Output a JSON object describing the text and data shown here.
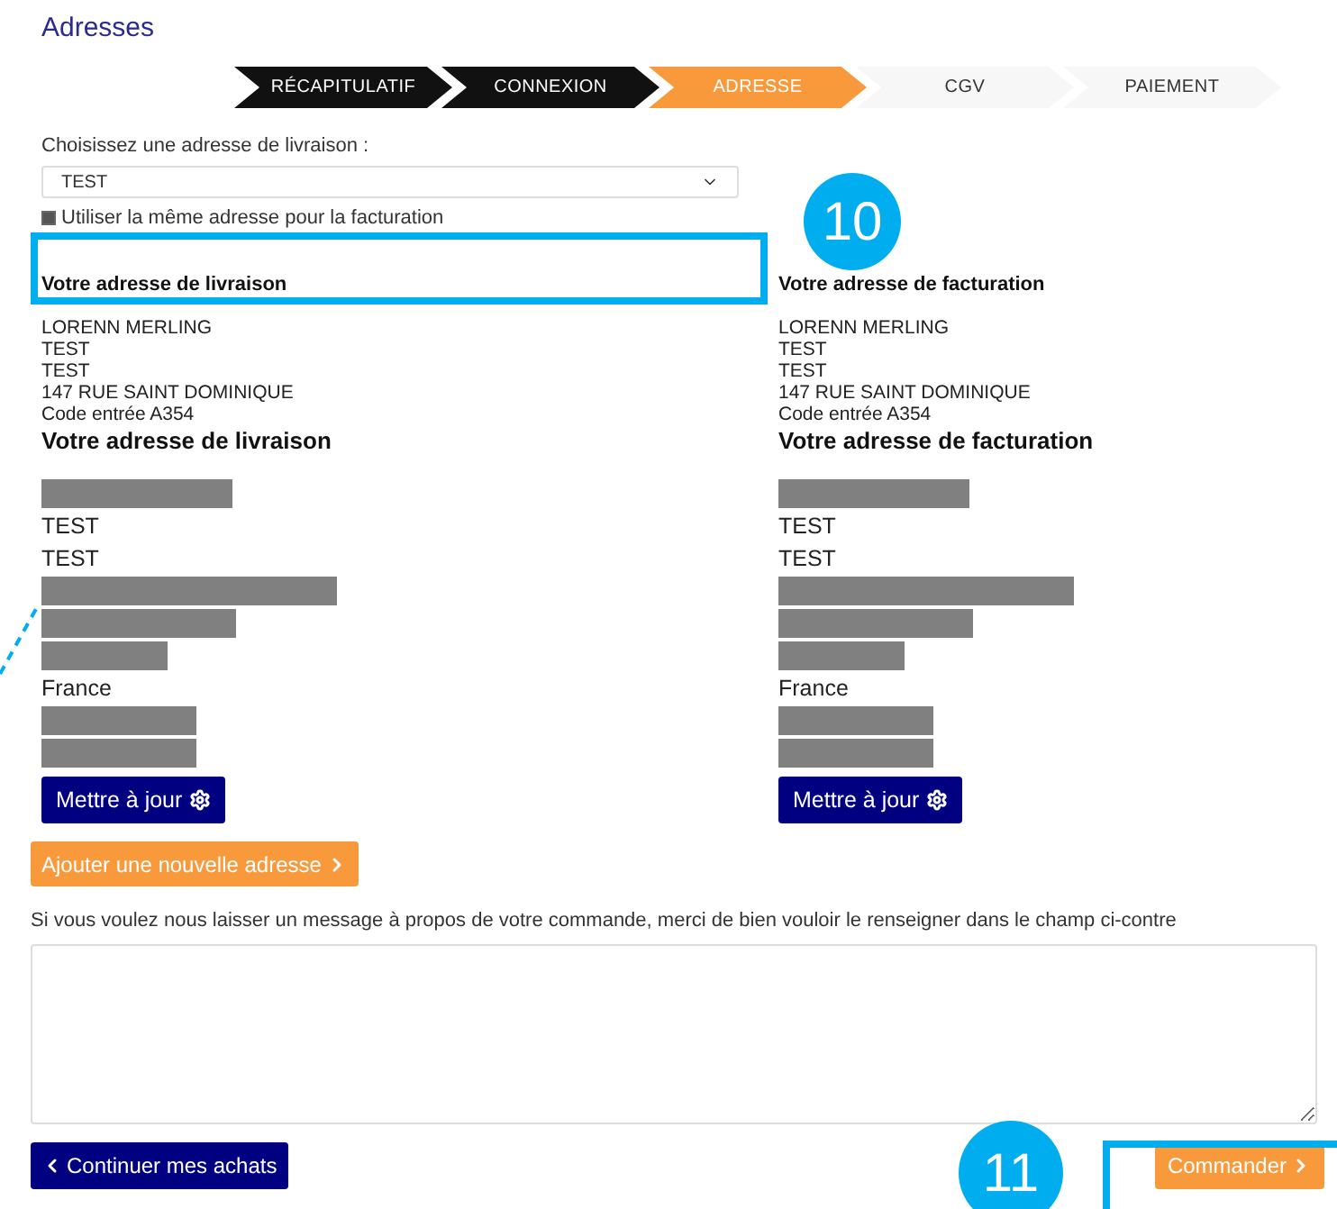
{
  "page_title": "Adresses",
  "steps": [
    {
      "label": "RÉCAPITULATIF",
      "completed": true,
      "selected": false
    },
    {
      "label": "CONNEXION",
      "completed": true,
      "selected": false
    },
    {
      "label": "ADRESSE",
      "completed": false,
      "selected": true
    },
    {
      "label": "CGV",
      "completed": false,
      "selected": false
    },
    {
      "label": "PAIEMENT",
      "completed": false,
      "selected": false
    }
  ],
  "delivery_select": {
    "label": "Choisissez une adresse de livraison :",
    "value": "TEST"
  },
  "same_billing": {
    "label": "Utiliser la même adresse pour la facturation",
    "checked": true
  },
  "upper_addresses": [
    {
      "heading": "Votre adresse de livraison",
      "lines": [
        "LORENN MERLING",
        "TEST",
        "TEST",
        "147 RUE SAINT DOMINIQUE",
        "Code entrée A354"
      ]
    },
    {
      "heading": "Votre adresse de facturation",
      "lines": [
        "LORENN MERLING",
        "TEST",
        "TEST",
        "147 RUE SAINT DOMINIQUE",
        "Code entrée A354"
      ]
    }
  ],
  "lower_addresses": [
    {
      "heading": "Votre adresse de livraison",
      "lines": [
        {
          "kind": "redacted"
        },
        {
          "kind": "text",
          "text": "TEST"
        },
        {
          "kind": "text",
          "text": "TEST"
        },
        {
          "kind": "redacted"
        },
        {
          "kind": "redacted"
        },
        {
          "kind": "redacted"
        },
        {
          "kind": "text",
          "text": "France"
        },
        {
          "kind": "redacted"
        },
        {
          "kind": "redacted"
        }
      ],
      "button": "Mettre à jour"
    },
    {
      "heading": "Votre adresse de facturation",
      "lines": [
        {
          "kind": "redacted"
        },
        {
          "kind": "text",
          "text": "TEST"
        },
        {
          "kind": "text",
          "text": "TEST"
        },
        {
          "kind": "redacted"
        },
        {
          "kind": "redacted"
        },
        {
          "kind": "redacted"
        },
        {
          "kind": "text",
          "text": "France"
        },
        {
          "kind": "redacted"
        },
        {
          "kind": "redacted"
        }
      ],
      "button": "Mettre à jour"
    }
  ],
  "add_address_button": "Ajouter une nouvelle adresse",
  "message": {
    "label": "Si vous voulez nous laisser un message à propos de votre commande, merci de bien vouloir le renseigner dans le champ ci-contre"
  },
  "continue_button": "Continuer mes achats",
  "order_button": "Commander",
  "annotations": [
    {
      "number": "10"
    },
    {
      "number": "11"
    }
  ]
}
